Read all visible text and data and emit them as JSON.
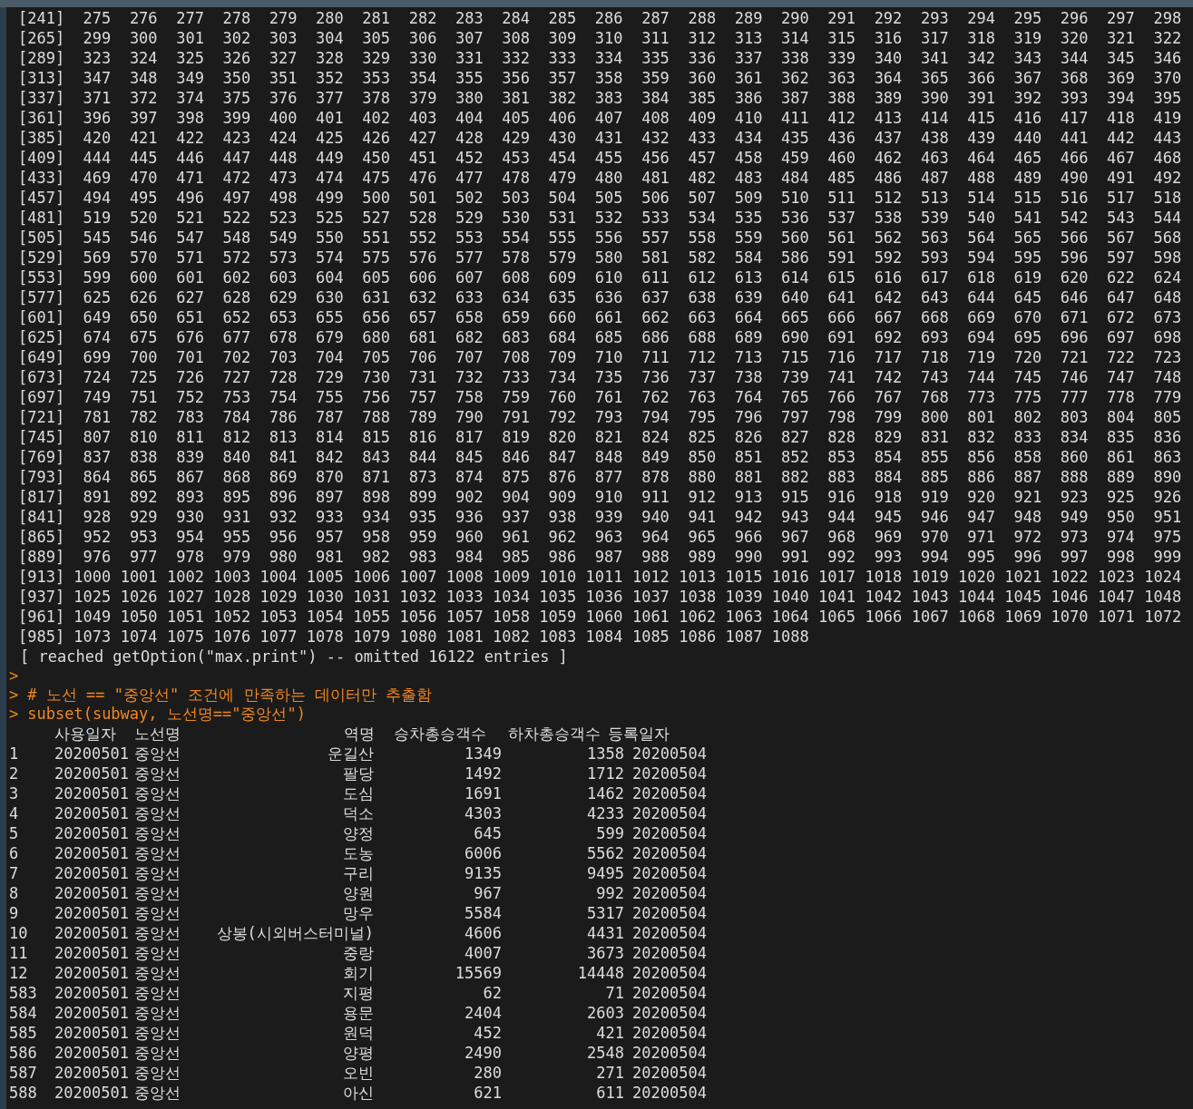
{
  "console": {
    "vector_rows": [
      {
        "index": "[241]",
        "values": [
          "275",
          "276",
          "277",
          "278",
          "279",
          "280",
          "281",
          "282",
          "283",
          "284",
          "285",
          "286",
          "287",
          "288",
          "289",
          "290",
          "291",
          "292",
          "293",
          "294",
          "295",
          "296",
          "297",
          "298"
        ]
      },
      {
        "index": "[265]",
        "values": [
          "299",
          "300",
          "301",
          "302",
          "303",
          "304",
          "305",
          "306",
          "307",
          "308",
          "309",
          "310",
          "311",
          "312",
          "313",
          "314",
          "315",
          "316",
          "317",
          "318",
          "319",
          "320",
          "321",
          "322"
        ]
      },
      {
        "index": "[289]",
        "values": [
          "323",
          "324",
          "325",
          "326",
          "327",
          "328",
          "329",
          "330",
          "331",
          "332",
          "333",
          "334",
          "335",
          "336",
          "337",
          "338",
          "339",
          "340",
          "341",
          "342",
          "343",
          "344",
          "345",
          "346"
        ]
      },
      {
        "index": "[313]",
        "values": [
          "347",
          "348",
          "349",
          "350",
          "351",
          "352",
          "353",
          "354",
          "355",
          "356",
          "357",
          "358",
          "359",
          "360",
          "361",
          "362",
          "363",
          "364",
          "365",
          "366",
          "367",
          "368",
          "369",
          "370"
        ]
      },
      {
        "index": "[337]",
        "values": [
          "371",
          "372",
          "374",
          "375",
          "376",
          "377",
          "378",
          "379",
          "380",
          "381",
          "382",
          "383",
          "384",
          "385",
          "386",
          "387",
          "388",
          "389",
          "390",
          "391",
          "392",
          "393",
          "394",
          "395"
        ]
      },
      {
        "index": "[361]",
        "values": [
          "396",
          "397",
          "398",
          "399",
          "400",
          "401",
          "402",
          "403",
          "404",
          "405",
          "406",
          "407",
          "408",
          "409",
          "410",
          "411",
          "412",
          "413",
          "414",
          "415",
          "416",
          "417",
          "418",
          "419"
        ]
      },
      {
        "index": "[385]",
        "values": [
          "420",
          "421",
          "422",
          "423",
          "424",
          "425",
          "426",
          "427",
          "428",
          "429",
          "430",
          "431",
          "432",
          "433",
          "434",
          "435",
          "436",
          "437",
          "438",
          "439",
          "440",
          "441",
          "442",
          "443"
        ]
      },
      {
        "index": "[409]",
        "values": [
          "444",
          "445",
          "446",
          "447",
          "448",
          "449",
          "450",
          "451",
          "452",
          "453",
          "454",
          "455",
          "456",
          "457",
          "458",
          "459",
          "460",
          "462",
          "463",
          "464",
          "465",
          "466",
          "467",
          "468"
        ]
      },
      {
        "index": "[433]",
        "values": [
          "469",
          "470",
          "471",
          "472",
          "473",
          "474",
          "475",
          "476",
          "477",
          "478",
          "479",
          "480",
          "481",
          "482",
          "483",
          "484",
          "485",
          "486",
          "487",
          "488",
          "489",
          "490",
          "491",
          "492"
        ]
      },
      {
        "index": "[457]",
        "values": [
          "494",
          "495",
          "496",
          "497",
          "498",
          "499",
          "500",
          "501",
          "502",
          "503",
          "504",
          "505",
          "506",
          "507",
          "509",
          "510",
          "511",
          "512",
          "513",
          "514",
          "515",
          "516",
          "517",
          "518"
        ]
      },
      {
        "index": "[481]",
        "values": [
          "519",
          "520",
          "521",
          "522",
          "523",
          "525",
          "527",
          "528",
          "529",
          "530",
          "531",
          "532",
          "533",
          "534",
          "535",
          "536",
          "537",
          "538",
          "539",
          "540",
          "541",
          "542",
          "543",
          "544"
        ]
      },
      {
        "index": "[505]",
        "values": [
          "545",
          "546",
          "547",
          "548",
          "549",
          "550",
          "551",
          "552",
          "553",
          "554",
          "555",
          "556",
          "557",
          "558",
          "559",
          "560",
          "561",
          "562",
          "563",
          "564",
          "565",
          "566",
          "567",
          "568"
        ]
      },
      {
        "index": "[529]",
        "values": [
          "569",
          "570",
          "571",
          "572",
          "573",
          "574",
          "575",
          "576",
          "577",
          "578",
          "579",
          "580",
          "581",
          "582",
          "584",
          "586",
          "591",
          "592",
          "593",
          "594",
          "595",
          "596",
          "597",
          "598"
        ]
      },
      {
        "index": "[553]",
        "values": [
          "599",
          "600",
          "601",
          "602",
          "603",
          "604",
          "605",
          "606",
          "607",
          "608",
          "609",
          "610",
          "611",
          "612",
          "613",
          "614",
          "615",
          "616",
          "617",
          "618",
          "619",
          "620",
          "622",
          "624"
        ]
      },
      {
        "index": "[577]",
        "values": [
          "625",
          "626",
          "627",
          "628",
          "629",
          "630",
          "631",
          "632",
          "633",
          "634",
          "635",
          "636",
          "637",
          "638",
          "639",
          "640",
          "641",
          "642",
          "643",
          "644",
          "645",
          "646",
          "647",
          "648"
        ]
      },
      {
        "index": "[601]",
        "values": [
          "649",
          "650",
          "651",
          "652",
          "653",
          "655",
          "656",
          "657",
          "658",
          "659",
          "660",
          "661",
          "662",
          "663",
          "664",
          "665",
          "666",
          "667",
          "668",
          "669",
          "670",
          "671",
          "672",
          "673"
        ]
      },
      {
        "index": "[625]",
        "values": [
          "674",
          "675",
          "676",
          "677",
          "678",
          "679",
          "680",
          "681",
          "682",
          "683",
          "684",
          "685",
          "686",
          "688",
          "689",
          "690",
          "691",
          "692",
          "693",
          "694",
          "695",
          "696",
          "697",
          "698"
        ]
      },
      {
        "index": "[649]",
        "values": [
          "699",
          "700",
          "701",
          "702",
          "703",
          "704",
          "705",
          "706",
          "707",
          "708",
          "709",
          "710",
          "711",
          "712",
          "713",
          "715",
          "716",
          "717",
          "718",
          "719",
          "720",
          "721",
          "722",
          "723"
        ]
      },
      {
        "index": "[673]",
        "values": [
          "724",
          "725",
          "726",
          "727",
          "728",
          "729",
          "730",
          "731",
          "732",
          "733",
          "734",
          "735",
          "736",
          "737",
          "738",
          "739",
          "741",
          "742",
          "743",
          "744",
          "745",
          "746",
          "747",
          "748"
        ]
      },
      {
        "index": "[697]",
        "values": [
          "749",
          "751",
          "752",
          "753",
          "754",
          "755",
          "756",
          "757",
          "758",
          "759",
          "760",
          "761",
          "762",
          "763",
          "764",
          "765",
          "766",
          "767",
          "768",
          "773",
          "775",
          "777",
          "778",
          "779"
        ]
      },
      {
        "index": "[721]",
        "values": [
          "781",
          "782",
          "783",
          "784",
          "786",
          "787",
          "788",
          "789",
          "790",
          "791",
          "792",
          "793",
          "794",
          "795",
          "796",
          "797",
          "798",
          "799",
          "800",
          "801",
          "802",
          "803",
          "804",
          "805"
        ]
      },
      {
        "index": "[745]",
        "values": [
          "807",
          "810",
          "811",
          "812",
          "813",
          "814",
          "815",
          "816",
          "817",
          "819",
          "820",
          "821",
          "824",
          "825",
          "826",
          "827",
          "828",
          "829",
          "831",
          "832",
          "833",
          "834",
          "835",
          "836"
        ]
      },
      {
        "index": "[769]",
        "values": [
          "837",
          "838",
          "839",
          "840",
          "841",
          "842",
          "843",
          "844",
          "845",
          "846",
          "847",
          "848",
          "849",
          "850",
          "851",
          "852",
          "853",
          "854",
          "855",
          "856",
          "858",
          "860",
          "861",
          "863"
        ]
      },
      {
        "index": "[793]",
        "values": [
          "864",
          "865",
          "867",
          "868",
          "869",
          "870",
          "871",
          "873",
          "874",
          "875",
          "876",
          "877",
          "878",
          "880",
          "881",
          "882",
          "883",
          "884",
          "885",
          "886",
          "887",
          "888",
          "889",
          "890"
        ]
      },
      {
        "index": "[817]",
        "values": [
          "891",
          "892",
          "893",
          "895",
          "896",
          "897",
          "898",
          "899",
          "902",
          "904",
          "909",
          "910",
          "911",
          "912",
          "913",
          "915",
          "916",
          "918",
          "919",
          "920",
          "921",
          "923",
          "925",
          "926"
        ]
      },
      {
        "index": "[841]",
        "values": [
          "928",
          "929",
          "930",
          "931",
          "932",
          "933",
          "934",
          "935",
          "936",
          "937",
          "938",
          "939",
          "940",
          "941",
          "942",
          "943",
          "944",
          "945",
          "946",
          "947",
          "948",
          "949",
          "950",
          "951"
        ]
      },
      {
        "index": "[865]",
        "values": [
          "952",
          "953",
          "954",
          "955",
          "956",
          "957",
          "958",
          "959",
          "960",
          "961",
          "962",
          "963",
          "964",
          "965",
          "966",
          "967",
          "968",
          "969",
          "970",
          "971",
          "972",
          "973",
          "974",
          "975"
        ]
      },
      {
        "index": "[889]",
        "values": [
          "976",
          "977",
          "978",
          "979",
          "980",
          "981",
          "982",
          "983",
          "984",
          "985",
          "986",
          "987",
          "988",
          "989",
          "990",
          "991",
          "992",
          "993",
          "994",
          "995",
          "996",
          "997",
          "998",
          "999"
        ]
      },
      {
        "index": "[913]",
        "values": [
          "1000",
          "1001",
          "1002",
          "1003",
          "1004",
          "1005",
          "1006",
          "1007",
          "1008",
          "1009",
          "1010",
          "1011",
          "1012",
          "1013",
          "1015",
          "1016",
          "1017",
          "1018",
          "1019",
          "1020",
          "1021",
          "1022",
          "1023",
          "1024"
        ]
      },
      {
        "index": "[937]",
        "values": [
          "1025",
          "1026",
          "1027",
          "1028",
          "1029",
          "1030",
          "1031",
          "1032",
          "1033",
          "1034",
          "1035",
          "1036",
          "1037",
          "1038",
          "1039",
          "1040",
          "1041",
          "1042",
          "1043",
          "1044",
          "1045",
          "1046",
          "1047",
          "1048"
        ]
      },
      {
        "index": "[961]",
        "values": [
          "1049",
          "1050",
          "1051",
          "1052",
          "1053",
          "1054",
          "1055",
          "1056",
          "1057",
          "1058",
          "1059",
          "1060",
          "1061",
          "1062",
          "1063",
          "1064",
          "1065",
          "1066",
          "1067",
          "1068",
          "1069",
          "1070",
          "1071",
          "1072"
        ]
      },
      {
        "index": "[985]",
        "values": [
          "1073",
          "1074",
          "1075",
          "1076",
          "1077",
          "1078",
          "1079",
          "1080",
          "1081",
          "1082",
          "1083",
          "1084",
          "1085",
          "1086",
          "1087",
          "1088"
        ]
      }
    ],
    "notice": "[ reached getOption(\"max.print\") -- omitted 16122 entries ]",
    "input_lines": [
      {
        "prompt": ">"
      },
      {
        "prompt": ">",
        "text": "# 노선 == \"중앙선\" 조건에 만족하는 데이터만 추출함"
      },
      {
        "prompt": ">",
        "text": "subset(subway, 노선명==\"중앙선\")"
      }
    ],
    "table": {
      "columns": [
        "사용일자",
        "노선명",
        "역명",
        "승차총승객수",
        "하차총승객수",
        "등록일자"
      ],
      "rows": [
        {
          "name": "1",
          "cells": [
            "20200501",
            "중앙선",
            "운길산",
            "1349",
            "1358",
            "20200504"
          ]
        },
        {
          "name": "2",
          "cells": [
            "20200501",
            "중앙선",
            "팔당",
            "1492",
            "1712",
            "20200504"
          ]
        },
        {
          "name": "3",
          "cells": [
            "20200501",
            "중앙선",
            "도심",
            "1691",
            "1462",
            "20200504"
          ]
        },
        {
          "name": "4",
          "cells": [
            "20200501",
            "중앙선",
            "덕소",
            "4303",
            "4233",
            "20200504"
          ]
        },
        {
          "name": "5",
          "cells": [
            "20200501",
            "중앙선",
            "양정",
            "645",
            "599",
            "20200504"
          ]
        },
        {
          "name": "6",
          "cells": [
            "20200501",
            "중앙선",
            "도농",
            "6006",
            "5562",
            "20200504"
          ]
        },
        {
          "name": "7",
          "cells": [
            "20200501",
            "중앙선",
            "구리",
            "9135",
            "9495",
            "20200504"
          ]
        },
        {
          "name": "8",
          "cells": [
            "20200501",
            "중앙선",
            "양원",
            "967",
            "992",
            "20200504"
          ]
        },
        {
          "name": "9",
          "cells": [
            "20200501",
            "중앙선",
            "망우",
            "5584",
            "5317",
            "20200504"
          ]
        },
        {
          "name": "10",
          "cells": [
            "20200501",
            "중앙선",
            "상봉(시외버스터미널)",
            "4606",
            "4431",
            "20200504"
          ]
        },
        {
          "name": "11",
          "cells": [
            "20200501",
            "중앙선",
            "중랑",
            "4007",
            "3673",
            "20200504"
          ]
        },
        {
          "name": "12",
          "cells": [
            "20200501",
            "중앙선",
            "회기",
            "15569",
            "14448",
            "20200504"
          ]
        },
        {
          "name": "583",
          "cells": [
            "20200501",
            "중앙선",
            "지평",
            "62",
            "71",
            "20200504"
          ]
        },
        {
          "name": "584",
          "cells": [
            "20200501",
            "중앙선",
            "용문",
            "2404",
            "2603",
            "20200504"
          ]
        },
        {
          "name": "585",
          "cells": [
            "20200501",
            "중앙선",
            "원덕",
            "452",
            "421",
            "20200504"
          ]
        },
        {
          "name": "586",
          "cells": [
            "20200501",
            "중앙선",
            "양평",
            "2490",
            "2548",
            "20200504"
          ]
        },
        {
          "name": "587",
          "cells": [
            "20200501",
            "중앙선",
            "오빈",
            "280",
            "271",
            "20200504"
          ]
        },
        {
          "name": "588",
          "cells": [
            "20200501",
            "중앙선",
            "아신",
            "621",
            "611",
            "20200504"
          ]
        }
      ]
    }
  }
}
